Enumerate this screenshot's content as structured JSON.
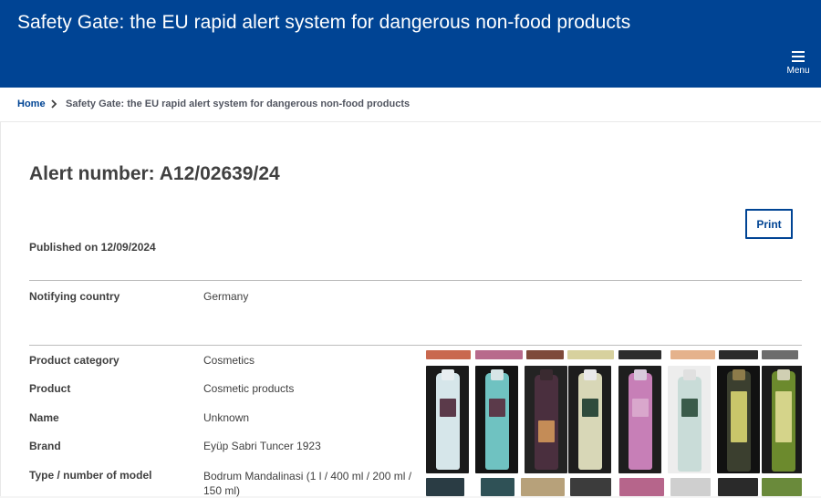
{
  "header": {
    "site_title": "Safety Gate: the EU rapid alert system for dangerous non-food products",
    "menu_label": "Menu"
  },
  "breadcrumb": {
    "home": "Home",
    "current": "Safety Gate: the EU rapid alert system for dangerous non-food products"
  },
  "alert": {
    "title": "Alert number: A12/02639/24",
    "print_label": "Print",
    "published": "Published on 12/09/2024"
  },
  "details": {
    "notifying_country_label": "Notifying country",
    "notifying_country_value": "Germany",
    "product_category_label": "Product category",
    "product_category_value": "Cosmetics",
    "product_label": "Product",
    "product_value": "Cosmetic products",
    "name_label": "Name",
    "name_value": "Unknown",
    "brand_label": "Brand",
    "brand_value": "Eyüp Sabri Tuncer 1923",
    "model_label": "Type / number of model",
    "model_value": "Bodrum Mandalinasi (1 l / 400 ml / 200 ml / 150 ml)"
  },
  "colors": {
    "header_blue": "#004494",
    "link_blue": "#004494"
  }
}
